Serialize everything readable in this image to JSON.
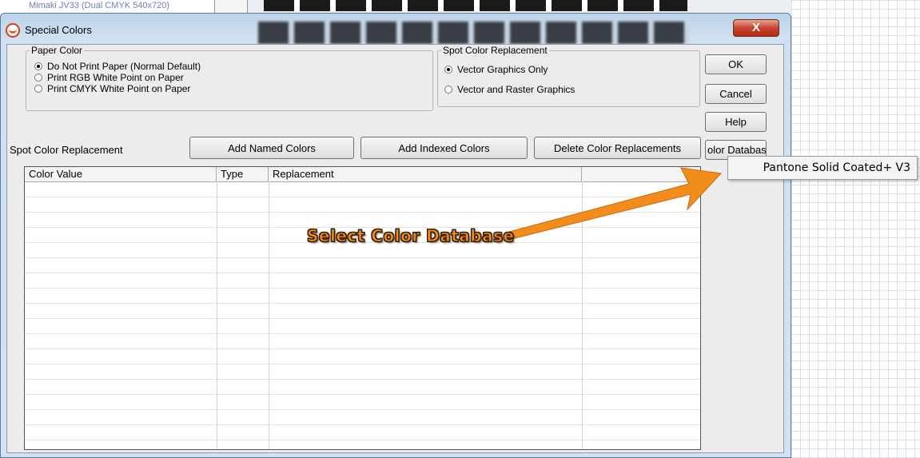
{
  "background": {
    "listing_text": "Mimaki JV33 (Dual CMYK 540x720)"
  },
  "window": {
    "title": "Special Colors",
    "close_glyph": "X"
  },
  "paper_color": {
    "legend": "Paper Color",
    "options": [
      {
        "label": "Do Not Print Paper  (Normal Default)",
        "checked": true
      },
      {
        "label": "Print RGB White Point on Paper",
        "checked": false
      },
      {
        "label": "Print CMYK White Point on Paper",
        "checked": false
      }
    ]
  },
  "spot_replacement_group": {
    "legend": "Spot Color Replacement",
    "options": [
      {
        "label": "Vector Graphics Only",
        "checked": true
      },
      {
        "label": "Vector and Raster Graphics",
        "checked": false
      }
    ]
  },
  "side_buttons": {
    "ok": "OK",
    "cancel": "Cancel",
    "help": "Help",
    "color_database": "olor Databas"
  },
  "toolbar": {
    "spot_label": "Spot Color Replacement",
    "add_named": "Add Named Colors",
    "add_indexed": "Add Indexed Colors",
    "delete_replacements": "Delete Color Replacements"
  },
  "table": {
    "columns": [
      "Color Value",
      "Type",
      "Replacement",
      ""
    ],
    "rows": []
  },
  "popup_menu": {
    "items": [
      "Pantone Solid Coated+ V3"
    ]
  },
  "annotation": {
    "text": "Select Color Database",
    "color": "#f28c1b"
  }
}
